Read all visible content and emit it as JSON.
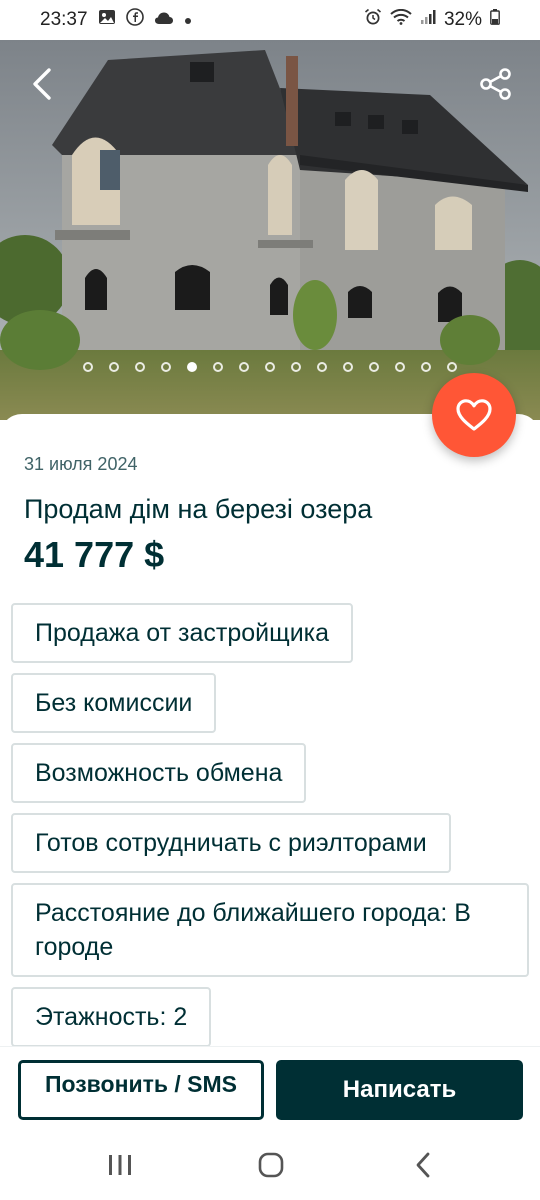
{
  "status_bar": {
    "time": "23:37",
    "battery": "32%",
    "left_icons": [
      "gallery-icon",
      "facebook-icon",
      "cloud-icon",
      "dot-icon"
    ],
    "right_icons": [
      "alarm-icon",
      "wifi-icon",
      "signal-icon",
      "battery-icon"
    ]
  },
  "gallery": {
    "image_count": 15,
    "active_index": 4
  },
  "listing": {
    "date": "31 июля 2024",
    "title": "Продам дім на березі озера",
    "price": "41 777 $"
  },
  "tags": [
    "Продажа от застройщика",
    "Без комиссии",
    "Возможность обмена",
    "Готов сотрудничать с риэлторами",
    "Расстояние до ближайшего города: В городе",
    "Этажность: 2",
    ""
  ],
  "actions": {
    "call_label": "Позвонить / SMS",
    "write_label": "Написать"
  },
  "colors": {
    "brand_dark": "#002f34",
    "favorite": "#ff5636",
    "tag_border": "#d8dfe0"
  }
}
